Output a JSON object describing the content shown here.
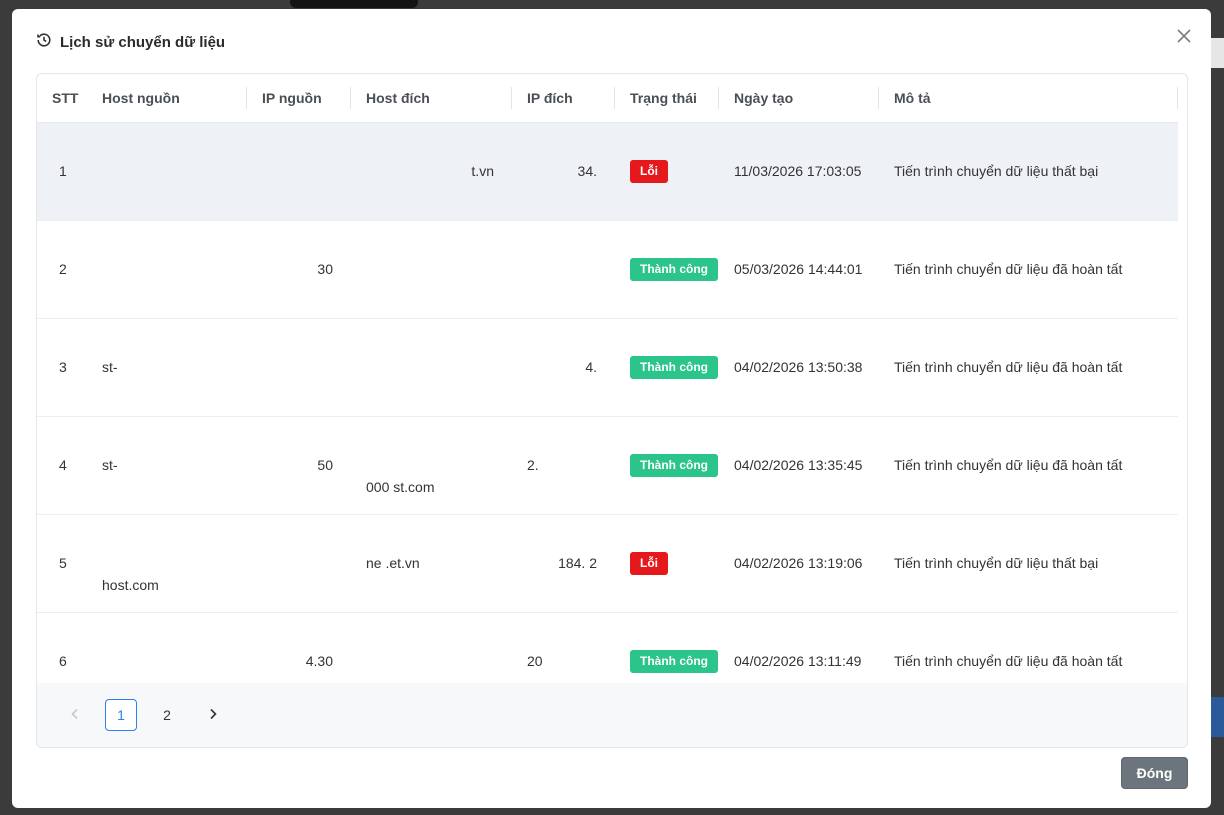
{
  "modal": {
    "title": "Lịch sử chuyển dữ liệu",
    "close_label": "Đóng"
  },
  "table": {
    "columns": [
      "STT",
      "Host nguồn",
      "IP nguồn",
      "Host đích",
      "IP đích",
      "Trạng thái",
      "Ngày tạo",
      "Mô tả"
    ],
    "rows": [
      {
        "stt": "1",
        "host_src": "",
        "ip_src": "",
        "host_dst": "t.vn",
        "ip_dst": "34.",
        "status": "Lỗi",
        "status_type": "error",
        "created": "11/03/2026 17:03:05",
        "desc": "Tiến trình chuyển dữ liệu thất bại"
      },
      {
        "stt": "2",
        "host_src": "",
        "ip_src": "30",
        "host_dst": "",
        "ip_dst": "",
        "status": "Thành công",
        "status_type": "success",
        "created": "05/03/2026 14:44:01",
        "desc": "Tiến trình chuyển dữ liệu đã hoàn tất"
      },
      {
        "stt": "3",
        "host_src": "st-",
        "ip_src": "",
        "host_dst": "",
        "ip_dst": "4.",
        "status": "Thành công",
        "status_type": "success",
        "created": "04/02/2026 13:50:38",
        "desc": "Tiến trình chuyển dữ liệu đã hoàn tất"
      },
      {
        "stt": "4",
        "host_src": "st-",
        "ip_src": "50",
        "host_dst": "000 st.com",
        "ip_dst": "2.",
        "status": "Thành công",
        "status_type": "success",
        "created": "04/02/2026 13:35:45",
        "desc": "Tiến trình chuyển dữ liệu đã hoàn tất"
      },
      {
        "stt": "5",
        "host_src": "host.com",
        "ip_src": "",
        "host_dst": "ne .et.vn",
        "ip_dst": "184. 2",
        "status": "Lỗi",
        "status_type": "error",
        "created": "04/02/2026 13:19:06",
        "desc": "Tiến trình chuyển dữ liệu thất bại"
      },
      {
        "stt": "6",
        "host_src": "",
        "ip_src": "4.30",
        "host_dst": "",
        "ip_dst": "20",
        "status": "Thành công",
        "status_type": "success",
        "created": "04/02/2026 13:11:49",
        "desc": "Tiến trình chuyển dữ liệu đã hoàn tất"
      }
    ]
  },
  "pagination": {
    "pages": [
      "1",
      "2"
    ],
    "current": "1"
  },
  "icons": {
    "title_icon": "history-clock-icon",
    "close_icon": "close-x-icon",
    "prev_icon": "chevron-left-icon",
    "next_icon": "chevron-right-icon"
  },
  "colors": {
    "error": "#e5181c",
    "success": "#2bc48a",
    "pager_active": "#2f80ed",
    "footer_button": "#6c757d"
  }
}
